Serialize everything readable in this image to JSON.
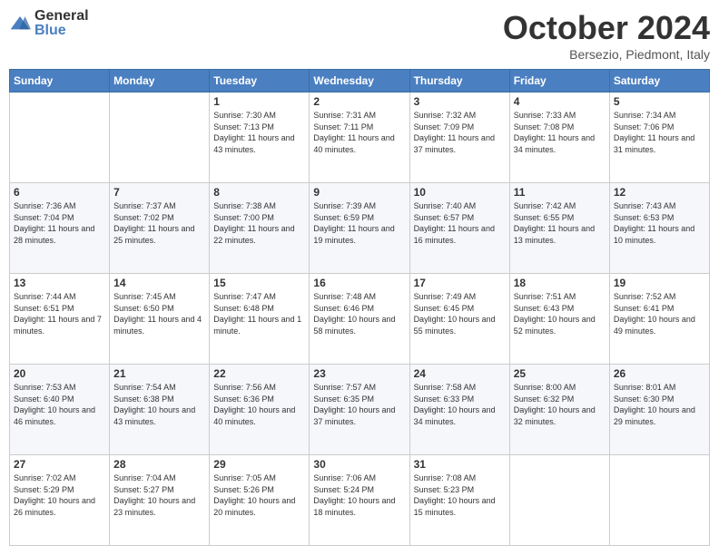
{
  "header": {
    "logo_general": "General",
    "logo_blue": "Blue",
    "title": "October 2024",
    "location": "Bersezio, Piedmont, Italy"
  },
  "days_of_week": [
    "Sunday",
    "Monday",
    "Tuesday",
    "Wednesday",
    "Thursday",
    "Friday",
    "Saturday"
  ],
  "weeks": [
    [
      {
        "day": "",
        "info": ""
      },
      {
        "day": "",
        "info": ""
      },
      {
        "day": "1",
        "info": "Sunrise: 7:30 AM\nSunset: 7:13 PM\nDaylight: 11 hours and 43 minutes."
      },
      {
        "day": "2",
        "info": "Sunrise: 7:31 AM\nSunset: 7:11 PM\nDaylight: 11 hours and 40 minutes."
      },
      {
        "day": "3",
        "info": "Sunrise: 7:32 AM\nSunset: 7:09 PM\nDaylight: 11 hours and 37 minutes."
      },
      {
        "day": "4",
        "info": "Sunrise: 7:33 AM\nSunset: 7:08 PM\nDaylight: 11 hours and 34 minutes."
      },
      {
        "day": "5",
        "info": "Sunrise: 7:34 AM\nSunset: 7:06 PM\nDaylight: 11 hours and 31 minutes."
      }
    ],
    [
      {
        "day": "6",
        "info": "Sunrise: 7:36 AM\nSunset: 7:04 PM\nDaylight: 11 hours and 28 minutes."
      },
      {
        "day": "7",
        "info": "Sunrise: 7:37 AM\nSunset: 7:02 PM\nDaylight: 11 hours and 25 minutes."
      },
      {
        "day": "8",
        "info": "Sunrise: 7:38 AM\nSunset: 7:00 PM\nDaylight: 11 hours and 22 minutes."
      },
      {
        "day": "9",
        "info": "Sunrise: 7:39 AM\nSunset: 6:59 PM\nDaylight: 11 hours and 19 minutes."
      },
      {
        "day": "10",
        "info": "Sunrise: 7:40 AM\nSunset: 6:57 PM\nDaylight: 11 hours and 16 minutes."
      },
      {
        "day": "11",
        "info": "Sunrise: 7:42 AM\nSunset: 6:55 PM\nDaylight: 11 hours and 13 minutes."
      },
      {
        "day": "12",
        "info": "Sunrise: 7:43 AM\nSunset: 6:53 PM\nDaylight: 11 hours and 10 minutes."
      }
    ],
    [
      {
        "day": "13",
        "info": "Sunrise: 7:44 AM\nSunset: 6:51 PM\nDaylight: 11 hours and 7 minutes."
      },
      {
        "day": "14",
        "info": "Sunrise: 7:45 AM\nSunset: 6:50 PM\nDaylight: 11 hours and 4 minutes."
      },
      {
        "day": "15",
        "info": "Sunrise: 7:47 AM\nSunset: 6:48 PM\nDaylight: 11 hours and 1 minute."
      },
      {
        "day": "16",
        "info": "Sunrise: 7:48 AM\nSunset: 6:46 PM\nDaylight: 10 hours and 58 minutes."
      },
      {
        "day": "17",
        "info": "Sunrise: 7:49 AM\nSunset: 6:45 PM\nDaylight: 10 hours and 55 minutes."
      },
      {
        "day": "18",
        "info": "Sunrise: 7:51 AM\nSunset: 6:43 PM\nDaylight: 10 hours and 52 minutes."
      },
      {
        "day": "19",
        "info": "Sunrise: 7:52 AM\nSunset: 6:41 PM\nDaylight: 10 hours and 49 minutes."
      }
    ],
    [
      {
        "day": "20",
        "info": "Sunrise: 7:53 AM\nSunset: 6:40 PM\nDaylight: 10 hours and 46 minutes."
      },
      {
        "day": "21",
        "info": "Sunrise: 7:54 AM\nSunset: 6:38 PM\nDaylight: 10 hours and 43 minutes."
      },
      {
        "day": "22",
        "info": "Sunrise: 7:56 AM\nSunset: 6:36 PM\nDaylight: 10 hours and 40 minutes."
      },
      {
        "day": "23",
        "info": "Sunrise: 7:57 AM\nSunset: 6:35 PM\nDaylight: 10 hours and 37 minutes."
      },
      {
        "day": "24",
        "info": "Sunrise: 7:58 AM\nSunset: 6:33 PM\nDaylight: 10 hours and 34 minutes."
      },
      {
        "day": "25",
        "info": "Sunrise: 8:00 AM\nSunset: 6:32 PM\nDaylight: 10 hours and 32 minutes."
      },
      {
        "day": "26",
        "info": "Sunrise: 8:01 AM\nSunset: 6:30 PM\nDaylight: 10 hours and 29 minutes."
      }
    ],
    [
      {
        "day": "27",
        "info": "Sunrise: 7:02 AM\nSunset: 5:29 PM\nDaylight: 10 hours and 26 minutes."
      },
      {
        "day": "28",
        "info": "Sunrise: 7:04 AM\nSunset: 5:27 PM\nDaylight: 10 hours and 23 minutes."
      },
      {
        "day": "29",
        "info": "Sunrise: 7:05 AM\nSunset: 5:26 PM\nDaylight: 10 hours and 20 minutes."
      },
      {
        "day": "30",
        "info": "Sunrise: 7:06 AM\nSunset: 5:24 PM\nDaylight: 10 hours and 18 minutes."
      },
      {
        "day": "31",
        "info": "Sunrise: 7:08 AM\nSunset: 5:23 PM\nDaylight: 10 hours and 15 minutes."
      },
      {
        "day": "",
        "info": ""
      },
      {
        "day": "",
        "info": ""
      }
    ]
  ]
}
